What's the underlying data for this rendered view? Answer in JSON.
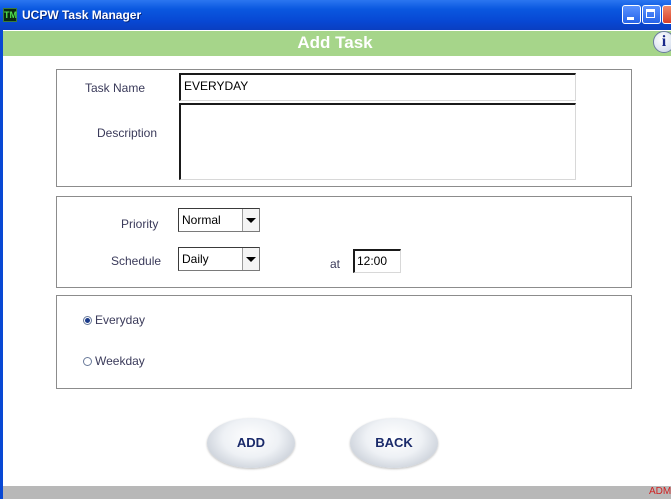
{
  "window": {
    "title": "UCPW Task Manager",
    "icon_text": "TM"
  },
  "header": {
    "title": "Add Task",
    "info_icon_glyph": "i"
  },
  "form": {
    "task_name_label": "Task Name",
    "task_name_value": "EVERYDAY",
    "description_label": "Description",
    "description_value": "",
    "priority_label": "Priority",
    "priority_value": "Normal",
    "schedule_label": "Schedule",
    "schedule_value": "Daily",
    "at_label": "at",
    "time_value": "12:00",
    "radio_everyday_label": "Everyday",
    "radio_weekday_label": "Weekday",
    "selected_radio": "Everyday"
  },
  "buttons": {
    "add_label": "ADD",
    "back_label": "BACK"
  },
  "status": {
    "user_text": "ADMI"
  },
  "colors": {
    "titlebar": "#0a58e0",
    "header": "#a6d58a",
    "status_text": "#d02020"
  }
}
